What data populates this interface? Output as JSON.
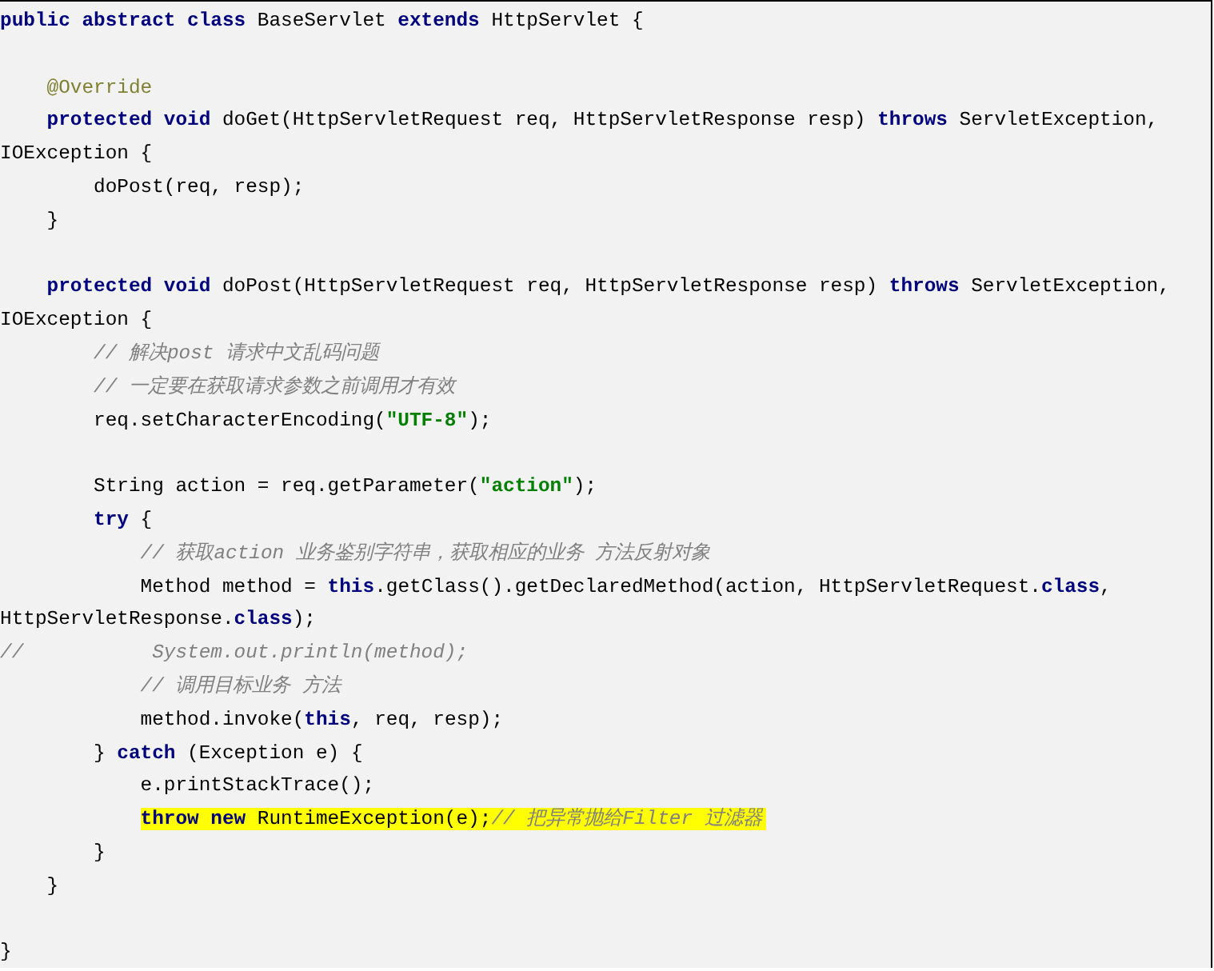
{
  "code_block": {
    "lines": [
      {
        "kind": "code",
        "highlighted": false,
        "segments": [
          {
            "kind": "keyword",
            "text": "public abstract class"
          },
          {
            "kind": "plain",
            "text": " BaseServlet "
          },
          {
            "kind": "keyword",
            "text": "extends"
          },
          {
            "kind": "plain",
            "text": " HttpServlet {"
          }
        ]
      },
      {
        "kind": "blank"
      },
      {
        "kind": "code",
        "highlighted": false,
        "segments": [
          {
            "kind": "annotation",
            "text": "    @Override"
          }
        ]
      },
      {
        "kind": "code",
        "highlighted": false,
        "segments": [
          {
            "kind": "keyword",
            "text": "    protected void"
          },
          {
            "kind": "plain",
            "text": " doGet(HttpServletRequest req, HttpServletResponse resp) "
          },
          {
            "kind": "keyword",
            "text": "throws"
          },
          {
            "kind": "plain",
            "text": " ServletException,"
          }
        ]
      },
      {
        "kind": "code",
        "highlighted": false,
        "segments": [
          {
            "kind": "plain",
            "text": "IOException {"
          }
        ]
      },
      {
        "kind": "code",
        "highlighted": false,
        "segments": [
          {
            "kind": "plain",
            "text": "        doPost(req, resp);"
          }
        ]
      },
      {
        "kind": "code",
        "highlighted": false,
        "segments": [
          {
            "kind": "plain",
            "text": "    }"
          }
        ]
      },
      {
        "kind": "blank"
      },
      {
        "kind": "code",
        "highlighted": false,
        "segments": [
          {
            "kind": "keyword",
            "text": "    protected void"
          },
          {
            "kind": "plain",
            "text": " doPost(HttpServletRequest req, HttpServletResponse resp) "
          },
          {
            "kind": "keyword",
            "text": "throws"
          },
          {
            "kind": "plain",
            "text": " ServletException,"
          }
        ]
      },
      {
        "kind": "code",
        "highlighted": false,
        "segments": [
          {
            "kind": "plain",
            "text": "IOException {"
          }
        ]
      },
      {
        "kind": "code",
        "highlighted": false,
        "segments": [
          {
            "kind": "comment",
            "text": "        // 解决post 请求中文乱码问题"
          }
        ]
      },
      {
        "kind": "code",
        "highlighted": false,
        "segments": [
          {
            "kind": "comment",
            "text": "        // 一定要在获取请求参数之前调用才有效"
          }
        ]
      },
      {
        "kind": "code",
        "highlighted": false,
        "segments": [
          {
            "kind": "plain",
            "text": "        req.setCharacterEncoding("
          },
          {
            "kind": "string",
            "text": "\"UTF-8\""
          },
          {
            "kind": "plain",
            "text": ");"
          }
        ]
      },
      {
        "kind": "blank"
      },
      {
        "kind": "code",
        "highlighted": false,
        "segments": [
          {
            "kind": "plain",
            "text": "        String action = req.getParameter("
          },
          {
            "kind": "string",
            "text": "\"action\""
          },
          {
            "kind": "plain",
            "text": ");"
          }
        ]
      },
      {
        "kind": "code",
        "highlighted": false,
        "segments": [
          {
            "kind": "keyword",
            "text": "        try"
          },
          {
            "kind": "plain",
            "text": " {"
          }
        ]
      },
      {
        "kind": "code",
        "highlighted": false,
        "segments": [
          {
            "kind": "comment",
            "text": "            // 获取action 业务鉴别字符串，获取相应的业务 方法反射对象"
          }
        ]
      },
      {
        "kind": "code",
        "highlighted": false,
        "segments": [
          {
            "kind": "plain",
            "text": "            Method method = "
          },
          {
            "kind": "keyword",
            "text": "this"
          },
          {
            "kind": "plain",
            "text": ".getClass().getDeclaredMethod(action, HttpServletRequest."
          },
          {
            "kind": "keyword",
            "text": "class"
          },
          {
            "kind": "plain",
            "text": ","
          }
        ]
      },
      {
        "kind": "code",
        "highlighted": false,
        "segments": [
          {
            "kind": "plain",
            "text": "HttpServletResponse."
          },
          {
            "kind": "keyword",
            "text": "class"
          },
          {
            "kind": "plain",
            "text": ");"
          }
        ]
      },
      {
        "kind": "code",
        "highlighted": false,
        "segments": [
          {
            "kind": "comment",
            "text": "//           System.out.println(method);"
          }
        ]
      },
      {
        "kind": "code",
        "highlighted": false,
        "segments": [
          {
            "kind": "comment",
            "text": "            // 调用目标业务 方法"
          }
        ]
      },
      {
        "kind": "code",
        "highlighted": false,
        "segments": [
          {
            "kind": "plain",
            "text": "            method.invoke("
          },
          {
            "kind": "keyword",
            "text": "this"
          },
          {
            "kind": "plain",
            "text": ", req, resp);"
          }
        ]
      },
      {
        "kind": "code",
        "highlighted": false,
        "segments": [
          {
            "kind": "plain",
            "text": "        } "
          },
          {
            "kind": "keyword",
            "text": "catch"
          },
          {
            "kind": "plain",
            "text": " (Exception e) {"
          }
        ]
      },
      {
        "kind": "code",
        "highlighted": false,
        "segments": [
          {
            "kind": "plain",
            "text": "            e.printStackTrace();"
          }
        ]
      },
      {
        "kind": "code",
        "highlighted": true,
        "segments": [
          {
            "kind": "keyword",
            "text": "            throw new"
          },
          {
            "kind": "plain",
            "text": " RuntimeException(e);"
          },
          {
            "kind": "comment",
            "text": "// 把异常抛给Filter 过滤器"
          }
        ]
      },
      {
        "kind": "code",
        "highlighted": false,
        "segments": [
          {
            "kind": "plain",
            "text": "        }"
          }
        ]
      },
      {
        "kind": "code",
        "highlighted": false,
        "segments": [
          {
            "kind": "plain",
            "text": "    }"
          }
        ]
      },
      {
        "kind": "blank"
      },
      {
        "kind": "code",
        "highlighted": false,
        "segments": [
          {
            "kind": "plain",
            "text": "}"
          }
        ]
      }
    ]
  }
}
